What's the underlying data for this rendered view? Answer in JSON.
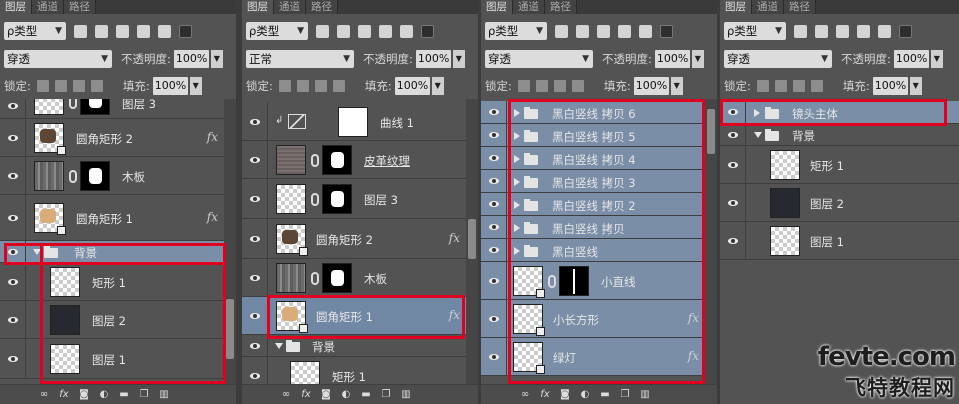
{
  "panels": [
    {
      "tabs": [
        "图层",
        "通道",
        "路径"
      ],
      "filter_label": "ρ类型",
      "blend_mode": "穿透",
      "opacity_label": "不透明度:",
      "opacity_value": "100%",
      "lock_label": "锁定:",
      "fill_label": "填充:",
      "fill_value": "100%",
      "layers": [
        "图层 3",
        "圆角矩形 2",
        "木板",
        "圆角矩形 1",
        "背景",
        "矩形 1",
        "图层 2",
        "图层 1"
      ],
      "fx_label": "fx"
    },
    {
      "tabs": [
        "图层",
        "通道",
        "路径"
      ],
      "filter_label": "ρ类型",
      "blend_mode": "正常",
      "opacity_label": "不透明度:",
      "opacity_value": "100%",
      "lock_label": "锁定:",
      "fill_label": "填充:",
      "fill_value": "100%",
      "layers": [
        "曲线 1",
        "皮革纹理",
        "图层 3",
        "圆角矩形 2",
        "木板",
        "圆角矩形 1",
        "背景",
        "矩形 1"
      ],
      "fx_label": "fx"
    },
    {
      "tabs": [
        "图层",
        "通道",
        "路径"
      ],
      "filter_label": "ρ类型",
      "blend_mode": "穿透",
      "opacity_label": "不透明度:",
      "opacity_value": "100%",
      "lock_label": "锁定:",
      "fill_label": "填充:",
      "fill_value": "100%",
      "layers": [
        "黑白竖线 拷贝 6",
        "黑白竖线 拷贝 5",
        "黑白竖线 拷贝 4",
        "黑白竖线 拷贝 3",
        "黑白竖线 拷贝 2",
        "黑白竖线 拷贝",
        "黑白竖线",
        "小直线",
        "小长方形",
        "绿灯"
      ],
      "fx_label": "fx"
    },
    {
      "tabs": [
        "图层",
        "通道",
        "路径"
      ],
      "filter_label": "ρ类型",
      "blend_mode": "穿透",
      "opacity_label": "不透明度:",
      "opacity_value": "100%",
      "lock_label": "锁定:",
      "fill_label": "填充:",
      "fill_value": "100%",
      "layers": [
        "镜头主体",
        "背景",
        "矩形 1",
        "图层 2",
        "图层 1"
      ]
    }
  ],
  "watermark": {
    "line1": "fevte.com",
    "line2": "飞特教程网"
  },
  "colors": {
    "panel_bg": "#535353",
    "selected_row": "#7088a4",
    "highlight_box": "#e0001f"
  }
}
